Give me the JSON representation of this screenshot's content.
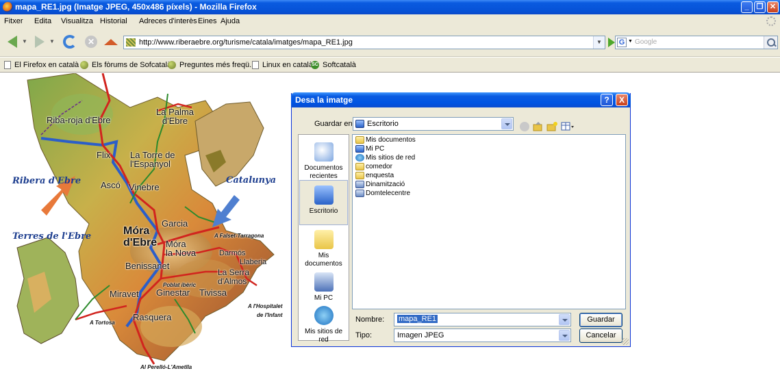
{
  "window": {
    "title": "mapa_RE1.jpg (Imatge JPEG, 450x486 píxels) - Mozilla Firefox"
  },
  "menu": [
    "Fitxer",
    "Edita",
    "Visualitza",
    "Historial",
    "Adreces d'interès",
    "Eines",
    "Ajuda"
  ],
  "navigation": {
    "url": "http://www.riberaebre.org/turisme/catala/imatges/mapa_RE1.jpg",
    "search_engine": "G",
    "search_placeholder": "Google"
  },
  "bookmarks": [
    {
      "label": "El Firefox en català",
      "icon": "page-icon"
    },
    {
      "label": "Els fòrums de Sofcatalà",
      "icon": "globe-icon"
    },
    {
      "label": "Preguntes més freqü...",
      "icon": "globe-icon"
    },
    {
      "label": "Linux en català",
      "icon": "page-icon"
    },
    {
      "label": "Softcatalà",
      "icon": "softcatala-icon"
    }
  ],
  "map": {
    "labels": {
      "riba_roja": "Riba-roja d'Ebre",
      "la_palma": "La Palma\nd'Ebre",
      "flix": "Flix",
      "la_torre": "La Torre de\nl'Espanyol",
      "asco": "Ascó",
      "vinebre": "Vinebre",
      "ribera_ebre": "Ribera d'Ebre",
      "catalunya": "Catalunya",
      "terres_ebre": "Terres de l'Ebre",
      "garcia": "Garcia",
      "mora_ebre": "Móra\nd'Ebre",
      "mora_nova": "Móra\nla Nova",
      "falset": "A Falset-Tarragona",
      "darmos": "Darmós",
      "llaberia": "Llaberia",
      "benissanet": "Benissanet",
      "la_serra": "La Serra\nd'Almos",
      "poblat": "Poblat ibèric",
      "miravet": "Miravet",
      "ginestar": "Ginestar",
      "tivissa": "Tivissa",
      "hospitalet": "A l'Hospitalet\nde l'Infant",
      "tortosa": "A Tortosa",
      "rasquera": "Rasquera",
      "perello": "Al Perelló-L'Ametlla"
    }
  },
  "dialog": {
    "title": "Desa la imatge",
    "save_in_label": "Guardar en:",
    "save_in_value": "Escritorio",
    "places": [
      {
        "label": "Documentos recientes"
      },
      {
        "label": "Escritorio"
      },
      {
        "label": "Mis documentos"
      },
      {
        "label": "Mi PC"
      },
      {
        "label": "Mis sitios de red"
      }
    ],
    "files": [
      {
        "name": "Mis documentos",
        "icon": "folder-icon"
      },
      {
        "name": "Mi PC",
        "icon": "computer-icon"
      },
      {
        "name": "Mis sitios de red",
        "icon": "network-icon"
      },
      {
        "name": "comedor",
        "icon": "folder-icon"
      },
      {
        "name": "enquesta",
        "icon": "folder-icon"
      },
      {
        "name": "Dinamització",
        "icon": "shortcut-icon"
      },
      {
        "name": "Domtelecentre",
        "icon": "shortcut-icon"
      }
    ],
    "filename_label": "Nombre:",
    "filename_value": "mapa_RE1",
    "type_label": "Tipo:",
    "type_value": "Imagen JPEG",
    "save_button": "Guardar",
    "cancel_button": "Cancelar",
    "help_button": "?",
    "close_button": "X"
  }
}
